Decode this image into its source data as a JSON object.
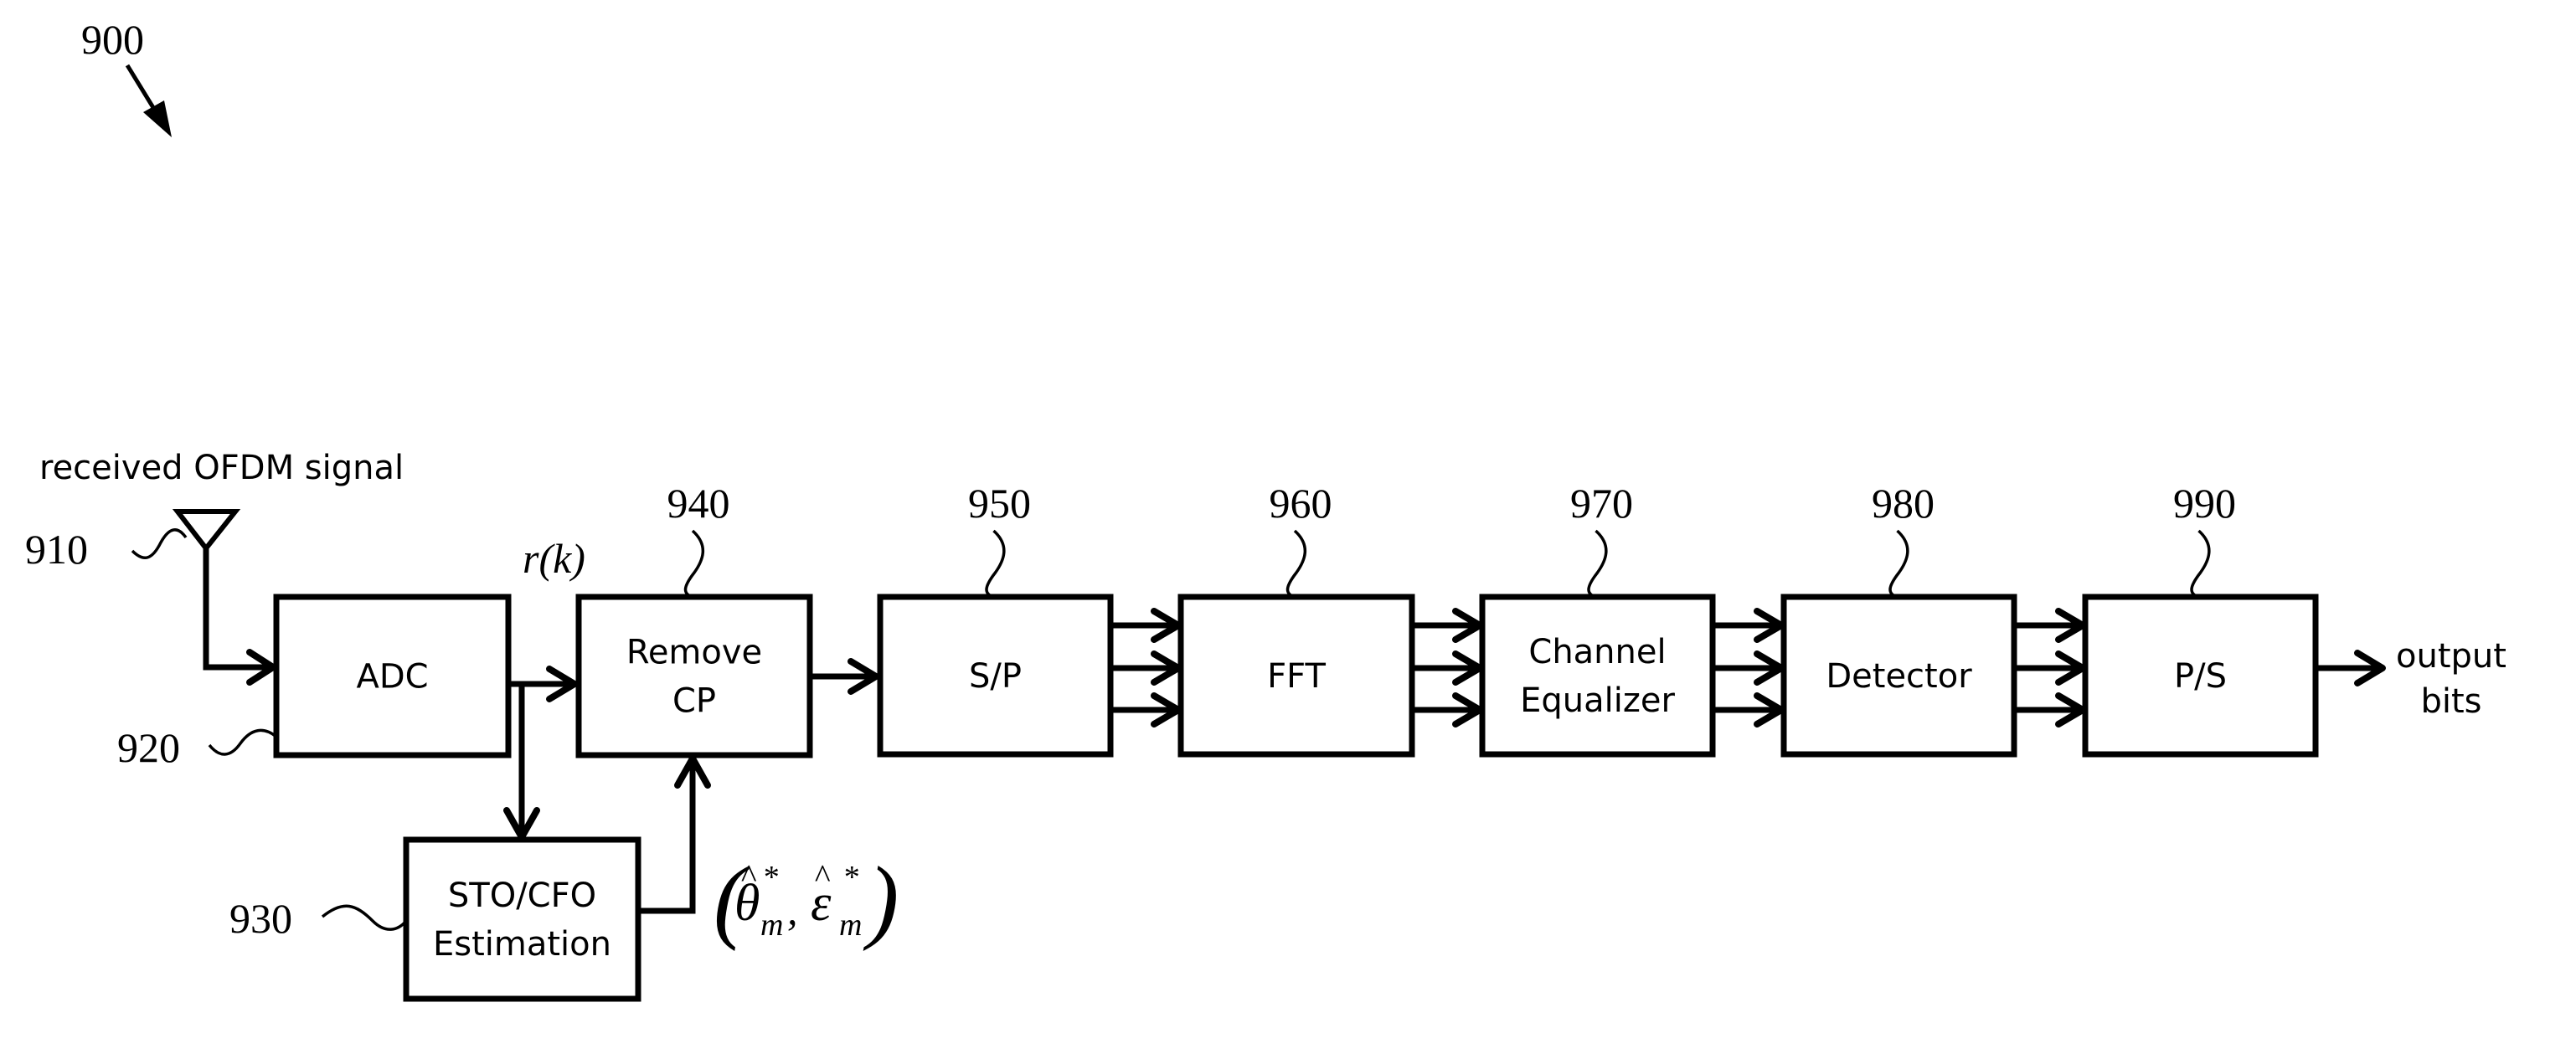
{
  "figure": {
    "reference": "900",
    "input_label": "received OFDM signal",
    "signal_label": "r(k)",
    "output_label_line1": "output",
    "output_label_line2": "bits",
    "estimate_label": {
      "open": "(",
      "theta": "θ",
      "epsilon": "ε",
      "hat": "^",
      "star": "*",
      "sub": "m",
      "comma": ",",
      "close": ")"
    }
  },
  "antenna": {
    "reference": "910"
  },
  "blocks": [
    {
      "id": "adc",
      "reference": "920",
      "lines": [
        "ADC"
      ]
    },
    {
      "id": "sto-cfo",
      "reference": "930",
      "lines": [
        "STO/CFO",
        "Estimation"
      ]
    },
    {
      "id": "remove-cp",
      "reference": "940",
      "lines": [
        "Remove",
        "CP"
      ]
    },
    {
      "id": "sp",
      "reference": "950",
      "lines": [
        "S/P"
      ]
    },
    {
      "id": "fft",
      "reference": "960",
      "lines": [
        "FFT"
      ]
    },
    {
      "id": "channel-equalizer",
      "reference": "970",
      "lines": [
        "Channel",
        "Equalizer"
      ]
    },
    {
      "id": "detector",
      "reference": "980",
      "lines": [
        "Detector"
      ]
    },
    {
      "id": "ps",
      "reference": "990",
      "lines": [
        "P/S"
      ]
    }
  ]
}
